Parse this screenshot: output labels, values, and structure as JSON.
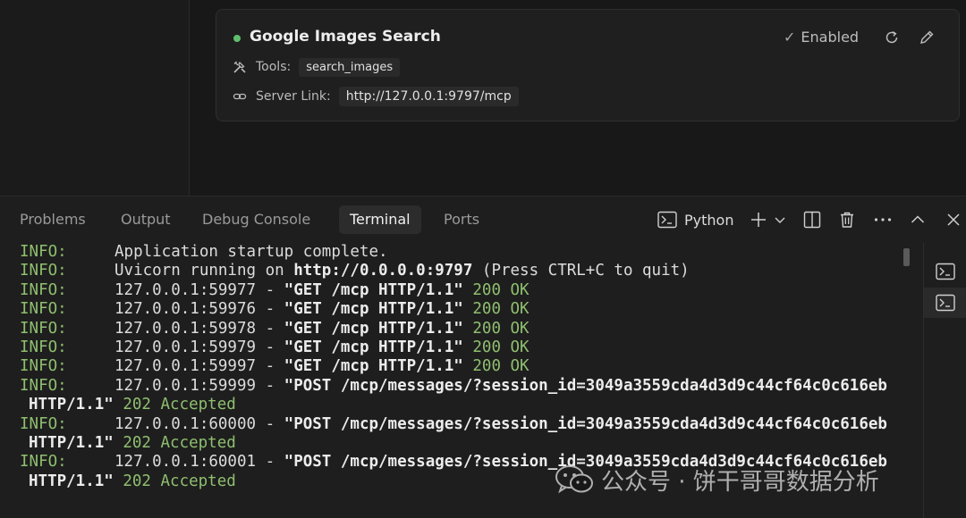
{
  "server_card": {
    "title": "Google Images Search",
    "status_color": "#5fbf6d",
    "status_label": "Enabled",
    "check_glyph": "✓",
    "tools_label": "Tools:",
    "tools": [
      "search_images"
    ],
    "server_link_label": "Server Link:",
    "server_link": "http://127.0.0.1:9797/mcp",
    "icons": {
      "tools": "tools-icon",
      "link": "link-icon",
      "refresh": "refresh-icon",
      "edit": "pencil-icon"
    }
  },
  "panel": {
    "tabs": [
      {
        "label": "Problems"
      },
      {
        "label": "Output"
      },
      {
        "label": "Debug Console"
      },
      {
        "label": "Terminal"
      },
      {
        "label": "Ports"
      }
    ],
    "active_tab": "Terminal",
    "terminal_profile": "Python",
    "icons": [
      "terminal-icon",
      "add-icon",
      "chevron-down-icon",
      "split-icon",
      "trash-icon",
      "ellipsis-icon",
      "chevron-up-icon",
      "close-icon"
    ]
  },
  "terminal": {
    "lines": [
      {
        "level": "INFO:",
        "text": "Application startup complete."
      },
      {
        "level": "INFO:",
        "pre": "Uvicorn running on ",
        "bold": "http://0.0.0.0:9797",
        "post": " (Press CTRL+C to quit)"
      },
      {
        "level": "INFO:",
        "pre": "127.0.0.1:59977 - ",
        "bold": "\"GET /mcp HTTP/1.1\"",
        "status": " 200 OK"
      },
      {
        "level": "INFO:",
        "pre": "127.0.0.1:59976 - ",
        "bold": "\"GET /mcp HTTP/1.1\"",
        "status": " 200 OK"
      },
      {
        "level": "INFO:",
        "pre": "127.0.0.1:59978 - ",
        "bold": "\"GET /mcp HTTP/1.1\"",
        "status": " 200 OK"
      },
      {
        "level": "INFO:",
        "pre": "127.0.0.1:59979 - ",
        "bold": "\"GET /mcp HTTP/1.1\"",
        "status": " 200 OK"
      },
      {
        "level": "INFO:",
        "pre": "127.0.0.1:59997 - ",
        "bold": "\"GET /mcp HTTP/1.1\"",
        "status": " 200 OK"
      },
      {
        "level": "INFO:",
        "pre": "127.0.0.1:59999 - ",
        "bold": "\"POST /mcp/messages/?session_id=3049a3559cda4d3d9c44cf64c0c616eb"
      },
      {
        "wrap": true,
        "bold": "HTTP/1.1\"",
        "status": " 202 Accepted"
      },
      {
        "level": "INFO:",
        "pre": "127.0.0.1:60000 - ",
        "bold": "\"POST /mcp/messages/?session_id=3049a3559cda4d3d9c44cf64c0c616eb"
      },
      {
        "wrap": true,
        "bold": "HTTP/1.1\"",
        "status": " 202 Accepted"
      },
      {
        "level": "INFO:",
        "pre": "127.0.0.1:60001 - ",
        "bold": "\"POST /mcp/messages/?session_id=3049a3559cda4d3d9c44cf64c0c616eb"
      },
      {
        "wrap": true,
        "bold": "HTTP/1.1\"",
        "status": " 202 Accepted"
      }
    ]
  },
  "terminal_instances": [
    {
      "icon": "terminal-icon",
      "active": false
    },
    {
      "icon": "terminal-icon",
      "active": true
    }
  ],
  "watermark": {
    "text": "公众号 · 饼干哥哥数据分析",
    "icon": "wechat-icon"
  },
  "colors": {
    "info": "#8fbf6f",
    "status_ok": "#8fbf6f",
    "accent_status": "#5fbf6d"
  }
}
